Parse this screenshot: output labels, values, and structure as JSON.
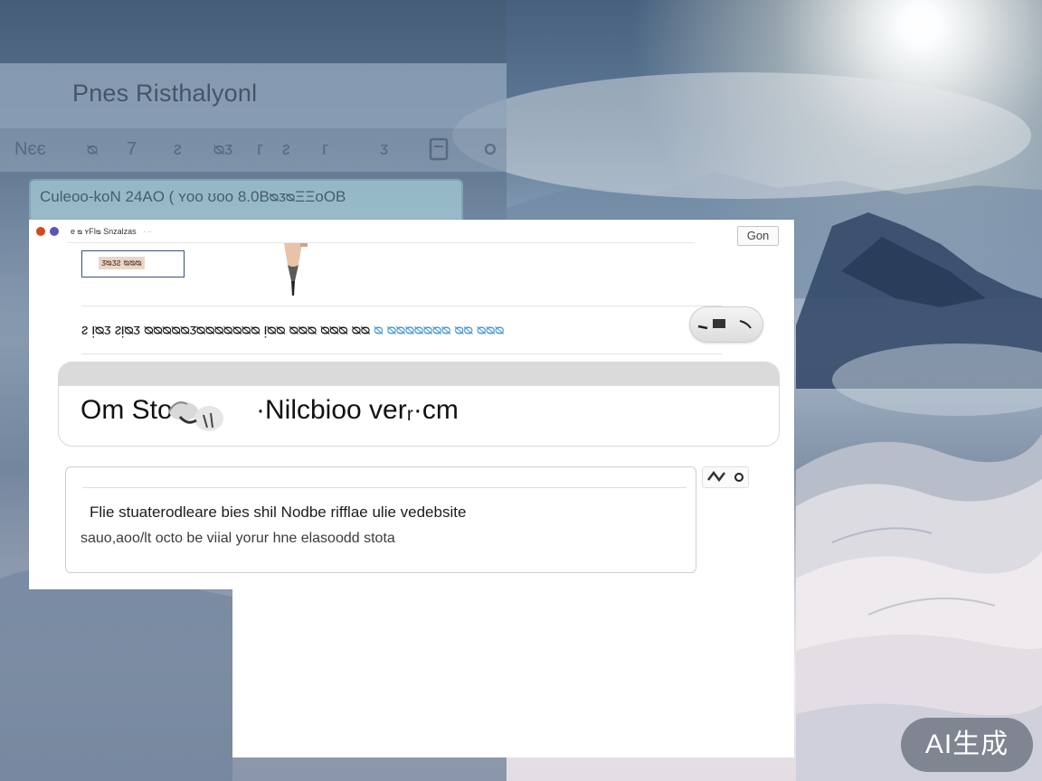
{
  "background_window": {
    "title": "Pnes Risthalyonl",
    "toolbar": [
      "Nєє",
      "ᴓ",
      "7",
      "ᴤ",
      "ᴓᴣ",
      "ᴦ",
      "ᴤ",
      "ᴦ",
      "ᴣ"
    ],
    "info_text": "Culeoo-koN 24AO ( ʏoo ʊoo 8.0BᴓᴣᴓΞΞoOB"
  },
  "browser": {
    "tab": {
      "label": "e ᴓ ʏFIᴓ Snzalzas",
      "extra": "· ··",
      "go_label": "Gon"
    },
    "toolbar": {
      "field_value": "ᴣᴓᴣᴤ ᴓᴓᴓ"
    },
    "info_row": {
      "main": "ᴤ ᴉᴓᴣ ᴤᴉᴓᴣ ᴓᴓᴓᴓᴓᴣᴓᴓᴓᴓᴓᴓᴓ ᴉᴓᴓ ᴓᴓᴓ ᴓᴓᴓ ᴓᴓ ",
      "accent": "ᴓ ᴓᴓᴓᴓᴓᴓᴓ ᴓᴓ ᴓᴓᴓ"
    },
    "search": {
      "title_start": "Om Sto",
      "title_rest": "·Nilcbioo verᵣ·cm"
    },
    "content": {
      "line1": "Flie stuaterodleare bies shil Nodbe rifflae ulie vedebsite",
      "line2": "sauo,aoo/lt octo be viial yorur hne elasoodd stota"
    }
  },
  "badge": {
    "label": "AI生成"
  },
  "colors": {
    "accent_blue": "#4a9bd8",
    "info_box": "#a8cfd8",
    "badge_bg": "#5f6976"
  }
}
